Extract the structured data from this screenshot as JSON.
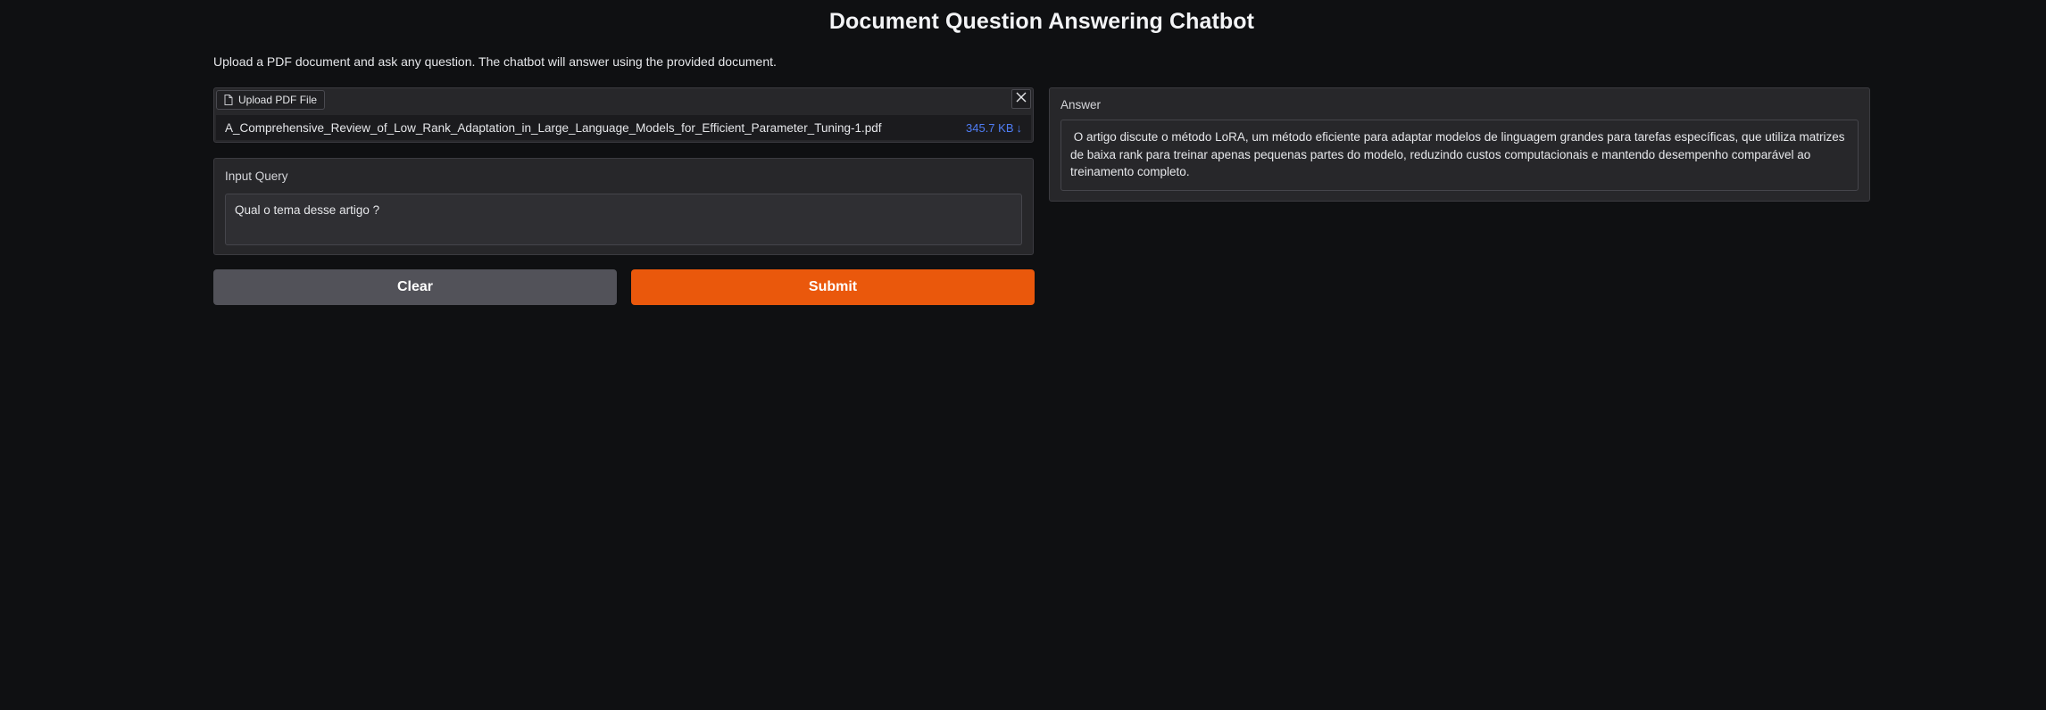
{
  "header": {
    "title": "Document Question Answering Chatbot",
    "description": "Upload a PDF document and ask any question. The chatbot will answer using the provided document."
  },
  "upload": {
    "tab_label": "Upload PDF File",
    "file_name": "A_Comprehensive_Review_of_Low_Rank_Adaptation_in_Large_Language_Models_for_Efficient_Parameter_Tuning-1.pdf",
    "file_size": "345.7 KB",
    "download_glyph": "↓",
    "icons": {
      "tab": "file-icon",
      "close": "close-icon"
    }
  },
  "query": {
    "label": "Input Query",
    "value": "Qual o tema desse artigo ?"
  },
  "buttons": {
    "clear_label": "Clear",
    "submit_label": "Submit"
  },
  "answer": {
    "label": "Answer",
    "text": " O artigo discute o método LoRA, um método eficiente para adaptar modelos de linguagem grandes para tarefas específicas, que utiliza matrizes de baixa rank para treinar apenas pequenas partes do modelo, reduzindo custos computacionais e mantendo desempenho comparável ao treinamento completo."
  },
  "colors": {
    "background": "#0f1012",
    "panel": "#27272a",
    "submit": "#ea580c",
    "clear": "#525259",
    "file_size_link": "#4f7df5"
  }
}
